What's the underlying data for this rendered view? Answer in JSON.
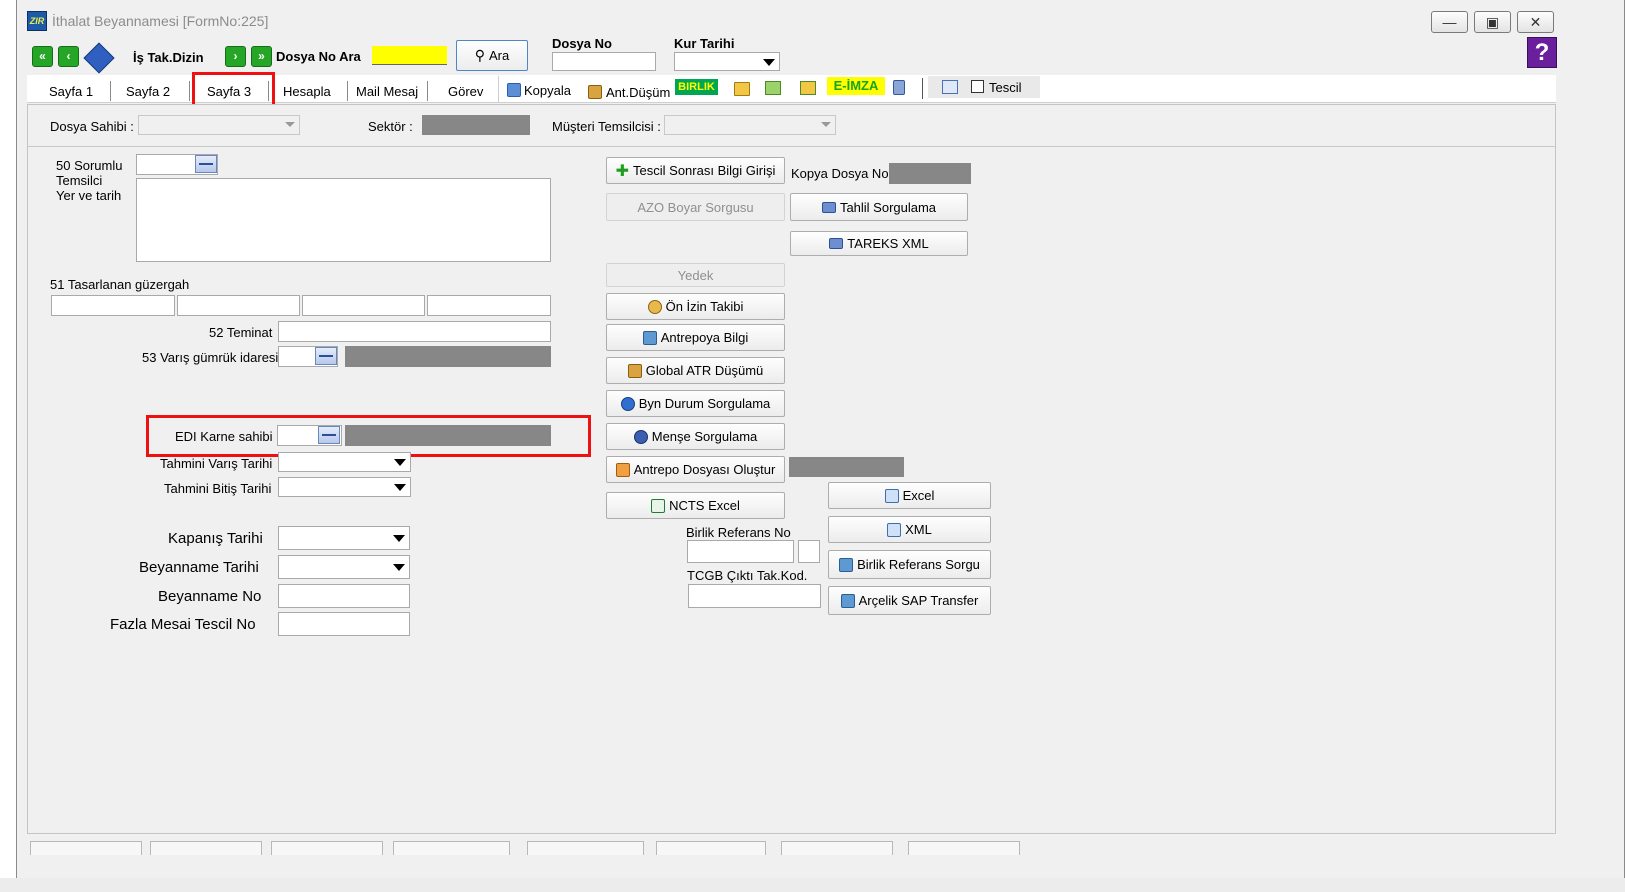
{
  "window": {
    "title": "İthalat Beyannamesi [FormNo:225]",
    "app_icon_text": "ZIR"
  },
  "toolbar": {
    "is_tak_dizin": "İş Tak.Dizin",
    "dosya_no_ara": "Dosya No Ara",
    "ara_button": "Ara",
    "dosya_no_label": "Dosya No",
    "kur_tarihi_label": "Kur Tarihi",
    "help": "?"
  },
  "tabs": [
    {
      "label": "Sayfa 1"
    },
    {
      "label": "Sayfa 2"
    },
    {
      "label": "Sayfa 3"
    },
    {
      "label": "Hesapla"
    },
    {
      "label": "Mail Mesaj"
    },
    {
      "label": "Görev"
    }
  ],
  "tab_actions": {
    "kopyala": "Kopyala",
    "ant_dusum": "Ant.Düşüm",
    "birlik": "BIRLIK",
    "e_imza": "E-İMZA",
    "tescil": "Tescil"
  },
  "header": {
    "dosya_sahibi": "Dosya Sahibi :",
    "sektor": "Sektör :",
    "musteri_temsilcisi": "Müşteri Temsilcisi :"
  },
  "form": {
    "f50_line1": "50 Sorumlu",
    "f50_line2": "Temsilci",
    "f50_line3": "Yer ve tarih",
    "f51": "51 Tasarlanan güzergah",
    "f52": "52 Teminat",
    "f53": "53 Varış gümrük idaresi",
    "edi_karne": "EDI Karne sahibi",
    "tahmini_varis": "Tahmini Varış Tarihi",
    "tahmini_bitis": "Tahmini Bitiş Tarihi",
    "kapanis_tarihi": "Kapanış Tarihi",
    "beyanname_tarihi": "Beyanname Tarihi",
    "beyanname_no": "Beyanname No",
    "fazla_mesai": "Fazla Mesai Tescil No"
  },
  "buttons": {
    "tescil_sonrasi": "Tescil Sonrası Bilgi Girişi",
    "kopya_dosya_no": "Kopya Dosya No",
    "azo_boyar": "AZO Boyar Sorgusu",
    "tahlil": "Tahlil Sorgulama",
    "tareks": "TAREKS XML",
    "yedek": "Yedek",
    "on_izin": "Ön İzin Takibi",
    "antrepoya_bilgi": "Antrepoya Bilgi",
    "global_atr": "Global ATR Düşümü",
    "byn_durum": "Byn Durum Sorgulama",
    "mense": "Menşe Sorgulama",
    "antrepo_dosyasi": "Antrepo Dosyası Oluştur",
    "ncts_excel": "NCTS Excel",
    "excel": "Excel",
    "xml": "XML",
    "birlik_referans_no": "Birlik Referans No",
    "birlik_referans_sorgu": "Birlik Referans Sorgu",
    "tcgb_cikti": "TCGB Çıktı Tak.Kod.",
    "arcelik_sap": "Arçelik SAP Transfer"
  },
  "colors": {
    "highlight_red": "#ee1111",
    "yellow_field": "#ffff00",
    "gray_field": "#878787",
    "birlik_bg": "#00a651",
    "eimza_bg": "#ffff00"
  }
}
